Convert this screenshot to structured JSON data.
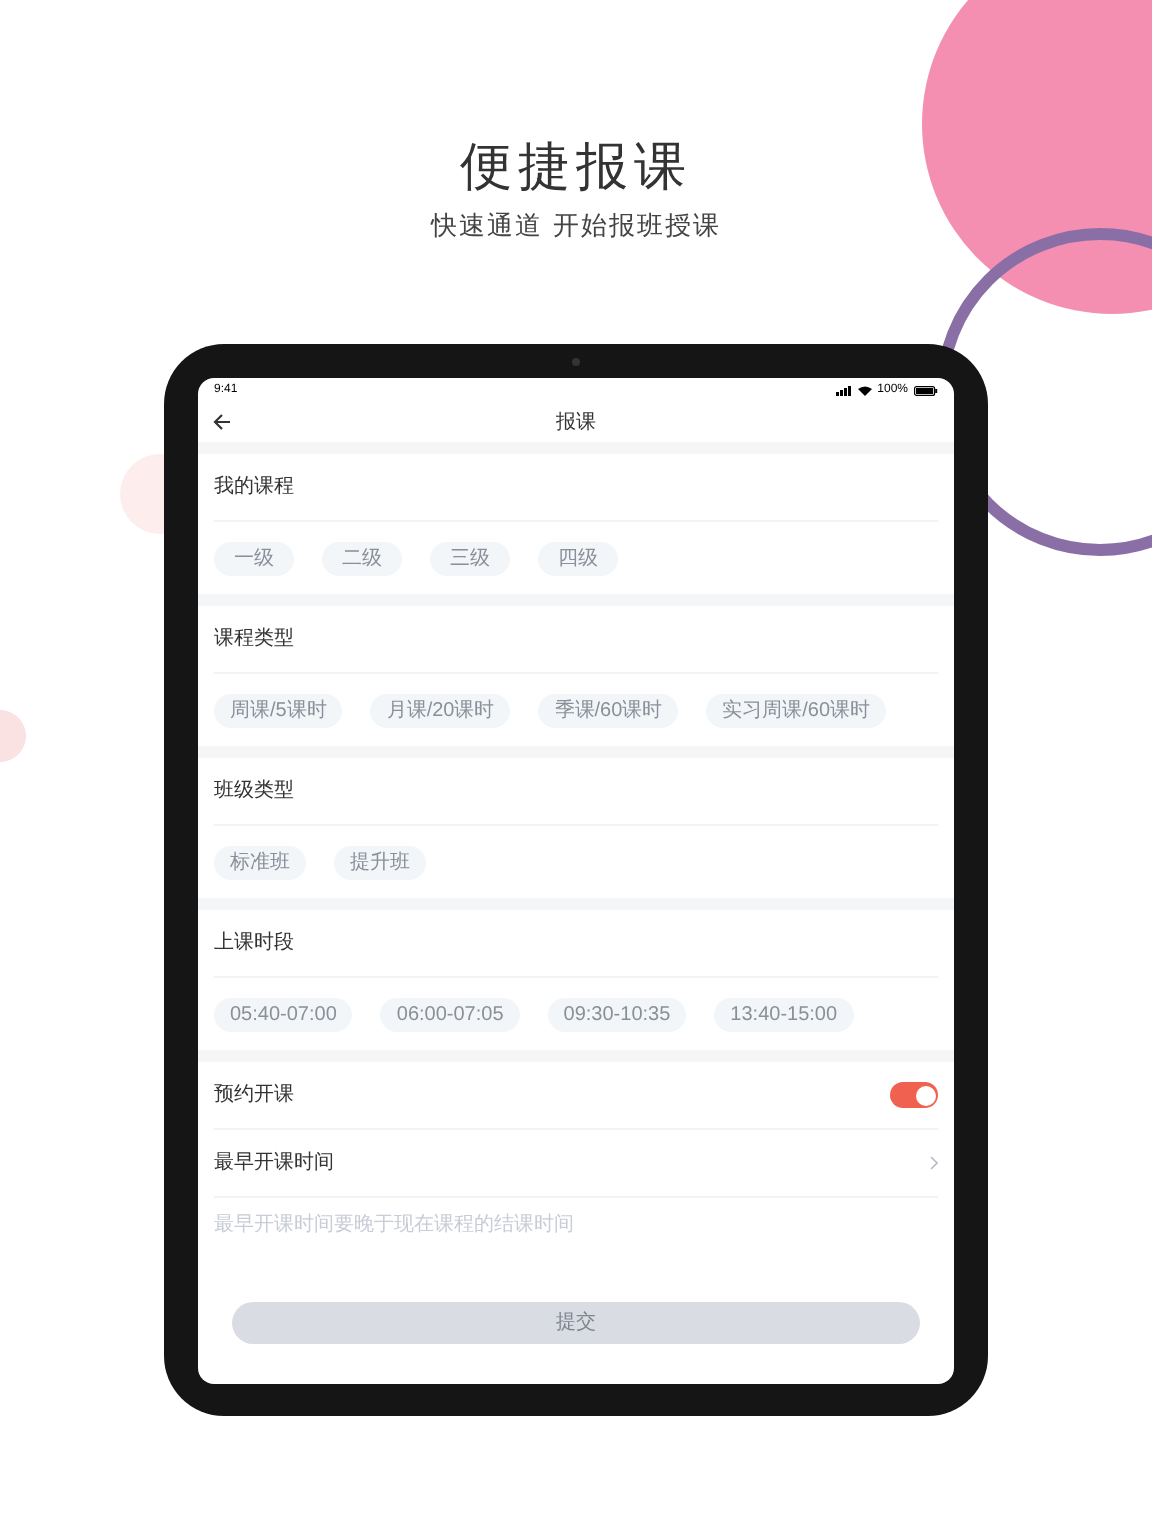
{
  "marketing": {
    "title": "便捷报课",
    "subtitle": "快速通道 开始报班授课"
  },
  "status_bar": {
    "time": "9:41",
    "battery": "100%"
  },
  "nav": {
    "title": "报课"
  },
  "sections": [
    {
      "title": "我的课程",
      "options": [
        {
          "label": "一级",
          "selected": false
        },
        {
          "label": "二级",
          "selected": false
        },
        {
          "label": "三级",
          "selected": false
        },
        {
          "label": "四级",
          "selected": false
        }
      ]
    },
    {
      "title": "课程类型",
      "options": [
        {
          "label": "周课/5课时",
          "selected": false
        },
        {
          "label": "月课/20课时",
          "selected": false
        },
        {
          "label": "季课/60课时",
          "selected": false
        },
        {
          "label": "实习周课/60课时",
          "selected": false
        }
      ]
    },
    {
      "title": "班级类型",
      "options": [
        {
          "label": "标准班",
          "selected": false
        },
        {
          "label": "提升班",
          "selected": false
        }
      ]
    },
    {
      "title": "上课时段",
      "options": [
        {
          "label": "05:40-07:00",
          "selected": false
        },
        {
          "label": "06:00-07:05",
          "selected": false
        },
        {
          "label": "09:30-10:35",
          "selected": false
        },
        {
          "label": "13:40-15:00",
          "selected": false
        }
      ]
    }
  ],
  "settings": [
    {
      "kind": "toggle",
      "label": "预约开课",
      "on": true
    },
    {
      "kind": "link",
      "label": "最早开课时间"
    }
  ],
  "hint": "最早开课时间要晚于现在课程的结课时间",
  "submit": {
    "label": "提交",
    "disabled": true
  }
}
